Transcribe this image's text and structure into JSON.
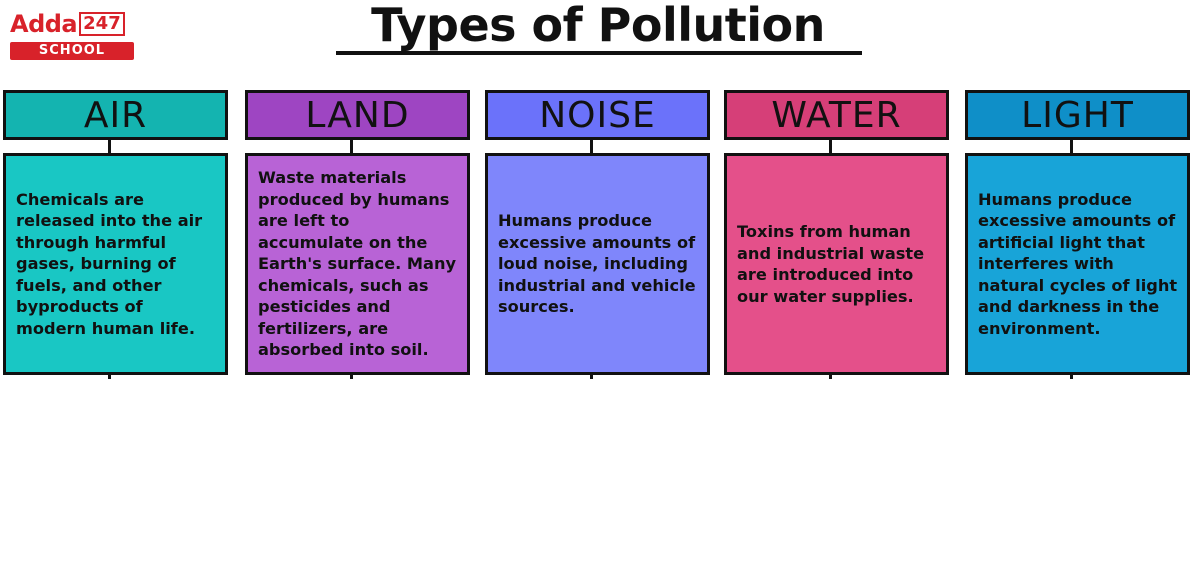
{
  "logo": {
    "brand": "Adda",
    "number": "247",
    "tagline": "SCHOOL"
  },
  "title": "Types of Pollution",
  "categories": [
    {
      "name": "AIR",
      "header_color": "#14b4b0",
      "box_color": "#19c7c4",
      "description": "Chemicals are released into the air through harmful gases, burning of fuels, and other byproducts of modern human life."
    },
    {
      "name": "LAND",
      "header_color": "#9e45c2",
      "box_color": "#b863d6",
      "description": "Waste materials produced by humans are left to accumulate on the Earth's surface. Many chemicals, such as pesticides and fertilizers, are absorbed into soil."
    },
    {
      "name": "NOISE",
      "header_color": "#6b72fa",
      "box_color": "#7f86fb",
      "description": "Humans produce excessive amounts of loud noise, including industrial and vehicle sources."
    },
    {
      "name": "WATER",
      "header_color": "#d63f78",
      "box_color": "#e4508a",
      "description": "Toxins from human and industrial waste are introduced into our water supplies."
    },
    {
      "name": "LIGHT",
      "header_color": "#0f8fc8",
      "box_color": "#18a4d8",
      "description": "Humans produce excessive amounts of artificial light that interferes with natural cycles of light and darkness in the environment."
    }
  ]
}
